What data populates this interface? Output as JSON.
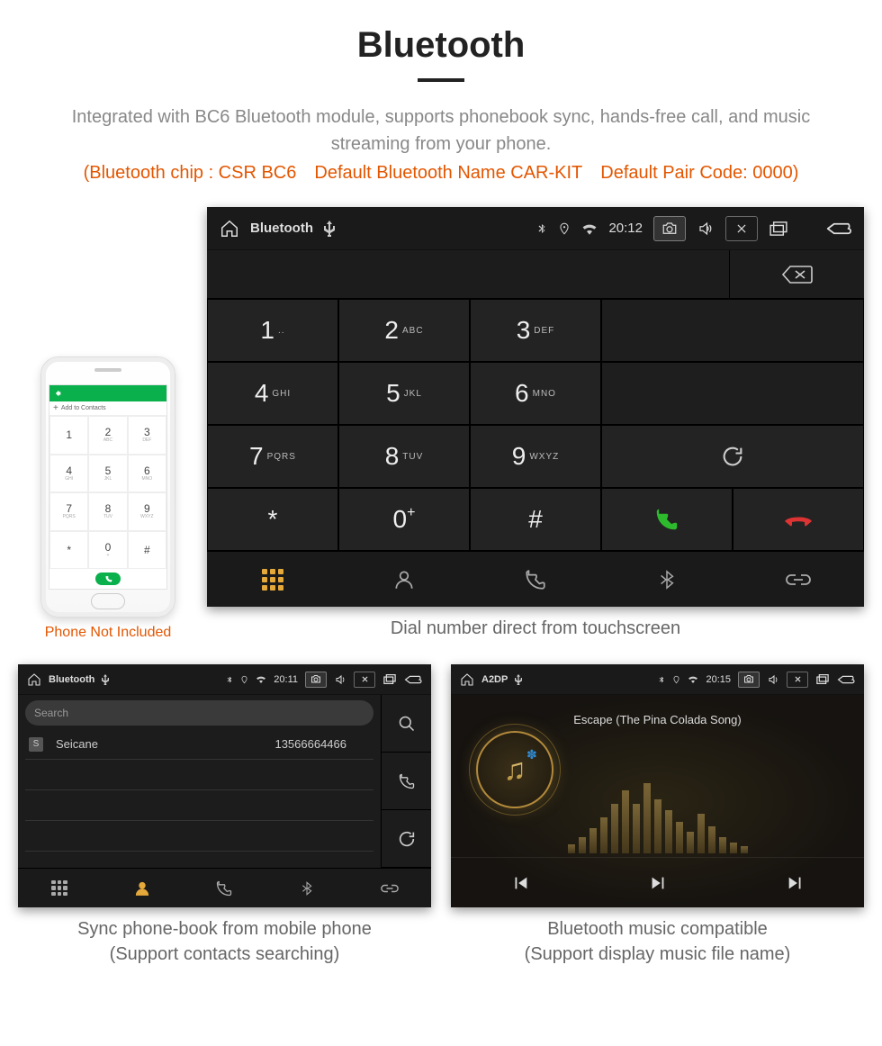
{
  "header": {
    "title": "Bluetooth",
    "description": "Integrated with BC6 Bluetooth module, supports phonebook sync, hands-free call, and music streaming from your phone.",
    "specs": "(Bluetooth chip : CSR BC6 Default Bluetooth Name CAR-KIT Default Pair Code: 0000)"
  },
  "phone_mock": {
    "add_contacts": "Add to Contacts",
    "keys": [
      {
        "d": "1",
        "l": ""
      },
      {
        "d": "2",
        "l": "ABC"
      },
      {
        "d": "3",
        "l": "DEF"
      },
      {
        "d": "4",
        "l": "GHI"
      },
      {
        "d": "5",
        "l": "JKL"
      },
      {
        "d": "6",
        "l": "MNO"
      },
      {
        "d": "7",
        "l": "PQRS"
      },
      {
        "d": "8",
        "l": "TUV"
      },
      {
        "d": "9",
        "l": "WXYZ"
      },
      {
        "d": "*",
        "l": ""
      },
      {
        "d": "0",
        "l": "+"
      },
      {
        "d": "#",
        "l": ""
      }
    ],
    "caption": "Phone Not Included"
  },
  "dialer": {
    "statusbar": {
      "title": "Bluetooth",
      "time": "20:12"
    },
    "keys": [
      {
        "d": "1",
        "l": ".."
      },
      {
        "d": "2",
        "l": "ABC"
      },
      {
        "d": "3",
        "l": "DEF"
      },
      {
        "d": "4",
        "l": "GHI"
      },
      {
        "d": "5",
        "l": "JKL"
      },
      {
        "d": "6",
        "l": "MNO"
      },
      {
        "d": "7",
        "l": "PQRS"
      },
      {
        "d": "8",
        "l": "TUV"
      },
      {
        "d": "9",
        "l": "WXYZ"
      },
      {
        "d": "*",
        "l": ""
      },
      {
        "d": "0",
        "l": "+"
      },
      {
        "d": "#",
        "l": ""
      }
    ],
    "caption": "Dial number direct from touchscreen"
  },
  "phonebook": {
    "statusbar": {
      "title": "Bluetooth",
      "time": "20:11"
    },
    "search_placeholder": "Search",
    "contact": {
      "initial": "S",
      "name": "Seicane",
      "number": "13566664466"
    },
    "caption_l1": "Sync phone-book from mobile phone",
    "caption_l2": "(Support contacts searching)"
  },
  "music": {
    "statusbar": {
      "title": "A2DP",
      "time": "20:15"
    },
    "track": "Escape (The Pina Colada Song)",
    "caption_l1": "Bluetooth music compatible",
    "caption_l2": "(Support display music file name)"
  }
}
